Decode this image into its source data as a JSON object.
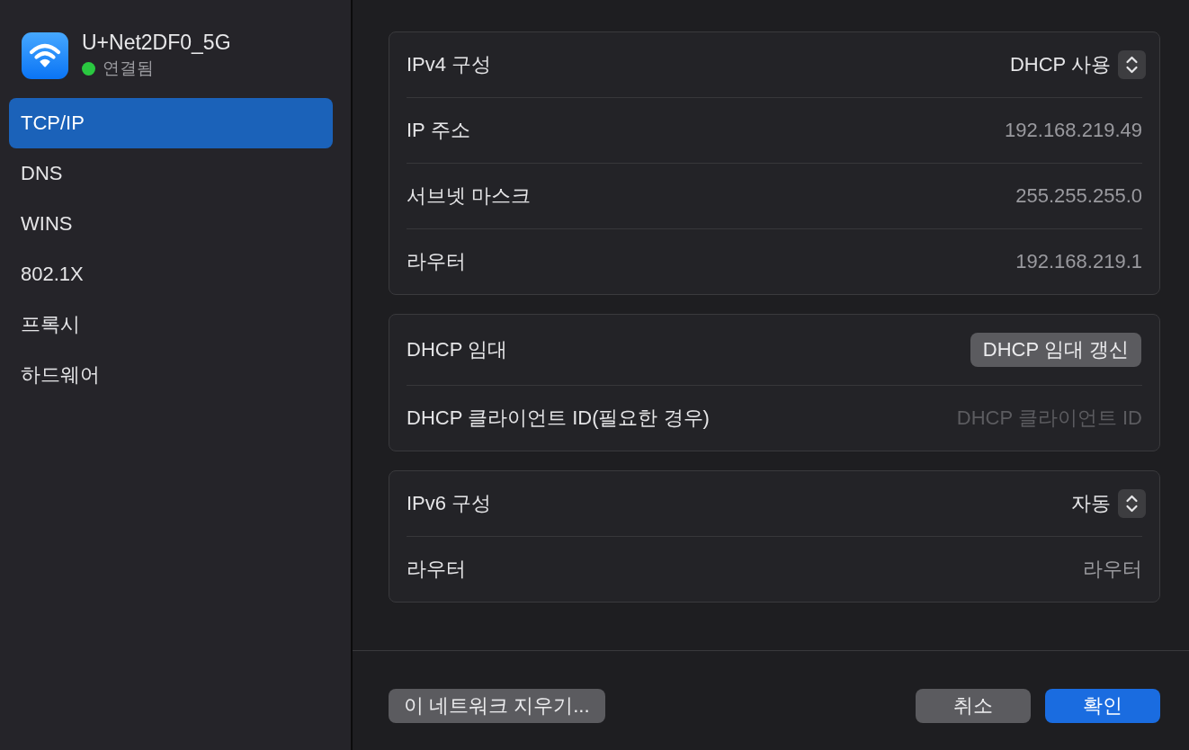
{
  "network": {
    "name": "U+Net2DF0_5G",
    "status": "연결됨",
    "connected": true
  },
  "sidebar": {
    "items": [
      {
        "label": "TCP/IP",
        "selected": true
      },
      {
        "label": "DNS",
        "selected": false
      },
      {
        "label": "WINS",
        "selected": false
      },
      {
        "label": "802.1X",
        "selected": false
      },
      {
        "label": "프록시",
        "selected": false
      },
      {
        "label": "하드웨어",
        "selected": false
      }
    ]
  },
  "groups": [
    {
      "rows": [
        {
          "kind": "popup",
          "label": "IPv4 구성",
          "value": "DHCP 사용"
        },
        {
          "kind": "value",
          "label": "IP 주소",
          "value": "192.168.219.49"
        },
        {
          "kind": "value",
          "label": "서브넷 마스크",
          "value": "255.255.255.0"
        },
        {
          "kind": "value",
          "label": "라우터",
          "value": "192.168.219.1"
        }
      ]
    },
    {
      "rows": [
        {
          "kind": "button",
          "label": "DHCP 임대",
          "value": "DHCP 임대 갱신"
        },
        {
          "kind": "field",
          "label": "DHCP 클라이언트 ID(필요한 경우)",
          "placeholder": "DHCP 클라이언트 ID"
        }
      ]
    },
    {
      "rows": [
        {
          "kind": "popup",
          "label": "IPv6 구성",
          "value": "자동"
        },
        {
          "kind": "value",
          "label": "라우터",
          "value": "라우터"
        }
      ]
    }
  ],
  "footer": {
    "delete_button": "이 네트워크 지우기...",
    "buttons": [
      {
        "label": "취소",
        "kind": "secondary"
      },
      {
        "label": "확인",
        "kind": "primary"
      }
    ]
  }
}
